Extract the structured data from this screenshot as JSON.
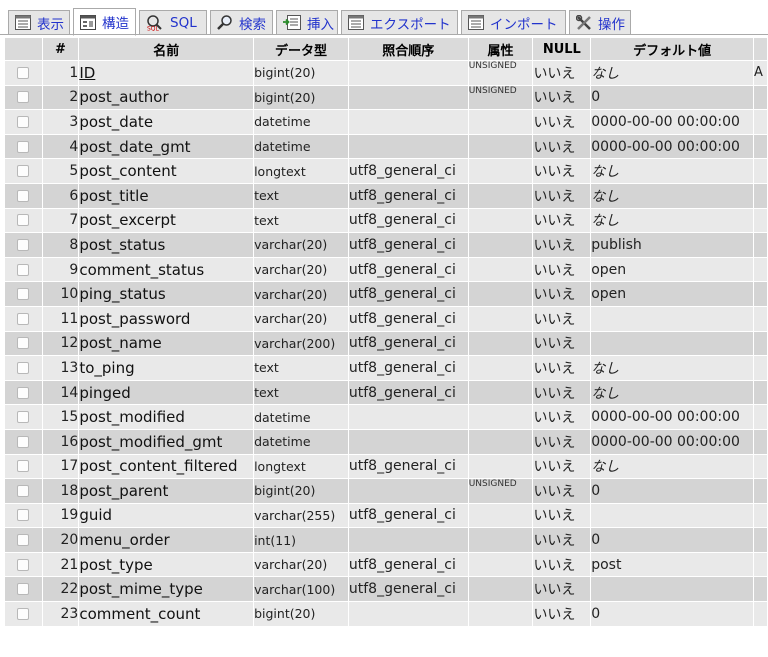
{
  "tabs": [
    {
      "label": "表示",
      "icon": "browse-icon",
      "active": false
    },
    {
      "label": "構造",
      "icon": "structure-icon",
      "active": true
    },
    {
      "label": "SQL",
      "icon": "sql-icon",
      "active": false
    },
    {
      "label": "検索",
      "icon": "search-icon",
      "active": false
    },
    {
      "label": "挿入",
      "icon": "insert-icon",
      "active": false
    },
    {
      "label": "エクスポート",
      "icon": "export-icon",
      "active": false
    },
    {
      "label": "インポート",
      "icon": "import-icon",
      "active": false
    },
    {
      "label": "操作",
      "icon": "operations-icon",
      "active": false
    }
  ],
  "columns": {
    "num": "#",
    "name": "名前",
    "type": "データ型",
    "collation": "照合順序",
    "attributes": "属性",
    "null": "NULL",
    "default": "デフォルト値"
  },
  "rows": [
    {
      "num": "1",
      "name": "ID",
      "type": "bigint(20)",
      "collation": "",
      "attributes": "UNSIGNED",
      "null": "いいえ",
      "default": "なし",
      "extra": "A"
    },
    {
      "num": "2",
      "name": "post_author",
      "type": "bigint(20)",
      "collation": "",
      "attributes": "UNSIGNED",
      "null": "いいえ",
      "default": "0",
      "extra": ""
    },
    {
      "num": "3",
      "name": "post_date",
      "type": "datetime",
      "collation": "",
      "attributes": "",
      "null": "いいえ",
      "default": "0000-00-00 00:00:00",
      "extra": ""
    },
    {
      "num": "4",
      "name": "post_date_gmt",
      "type": "datetime",
      "collation": "",
      "attributes": "",
      "null": "いいえ",
      "default": "0000-00-00 00:00:00",
      "extra": ""
    },
    {
      "num": "5",
      "name": "post_content",
      "type": "longtext",
      "collation": "utf8_general_ci",
      "attributes": "",
      "null": "いいえ",
      "default": "なし",
      "extra": ""
    },
    {
      "num": "6",
      "name": "post_title",
      "type": "text",
      "collation": "utf8_general_ci",
      "attributes": "",
      "null": "いいえ",
      "default": "なし",
      "extra": ""
    },
    {
      "num": "7",
      "name": "post_excerpt",
      "type": "text",
      "collation": "utf8_general_ci",
      "attributes": "",
      "null": "いいえ",
      "default": "なし",
      "extra": ""
    },
    {
      "num": "8",
      "name": "post_status",
      "type": "varchar(20)",
      "collation": "utf8_general_ci",
      "attributes": "",
      "null": "いいえ",
      "default": "publish",
      "extra": ""
    },
    {
      "num": "9",
      "name": "comment_status",
      "type": "varchar(20)",
      "collation": "utf8_general_ci",
      "attributes": "",
      "null": "いいえ",
      "default": "open",
      "extra": ""
    },
    {
      "num": "10",
      "name": "ping_status",
      "type": "varchar(20)",
      "collation": "utf8_general_ci",
      "attributes": "",
      "null": "いいえ",
      "default": "open",
      "extra": ""
    },
    {
      "num": "11",
      "name": "post_password",
      "type": "varchar(20)",
      "collation": "utf8_general_ci",
      "attributes": "",
      "null": "いいえ",
      "default": "",
      "extra": ""
    },
    {
      "num": "12",
      "name": "post_name",
      "type": "varchar(200)",
      "collation": "utf8_general_ci",
      "attributes": "",
      "null": "いいえ",
      "default": "",
      "extra": ""
    },
    {
      "num": "13",
      "name": "to_ping",
      "type": "text",
      "collation": "utf8_general_ci",
      "attributes": "",
      "null": "いいえ",
      "default": "なし",
      "extra": ""
    },
    {
      "num": "14",
      "name": "pinged",
      "type": "text",
      "collation": "utf8_general_ci",
      "attributes": "",
      "null": "いいえ",
      "default": "なし",
      "extra": ""
    },
    {
      "num": "15",
      "name": "post_modified",
      "type": "datetime",
      "collation": "",
      "attributes": "",
      "null": "いいえ",
      "default": "0000-00-00 00:00:00",
      "extra": ""
    },
    {
      "num": "16",
      "name": "post_modified_gmt",
      "type": "datetime",
      "collation": "",
      "attributes": "",
      "null": "いいえ",
      "default": "0000-00-00 00:00:00",
      "extra": ""
    },
    {
      "num": "17",
      "name": "post_content_filtered",
      "type": "longtext",
      "collation": "utf8_general_ci",
      "attributes": "",
      "null": "いいえ",
      "default": "なし",
      "extra": ""
    },
    {
      "num": "18",
      "name": "post_parent",
      "type": "bigint(20)",
      "collation": "",
      "attributes": "UNSIGNED",
      "null": "いいえ",
      "default": "0",
      "extra": ""
    },
    {
      "num": "19",
      "name": "guid",
      "type": "varchar(255)",
      "collation": "utf8_general_ci",
      "attributes": "",
      "null": "いいえ",
      "default": "",
      "extra": ""
    },
    {
      "num": "20",
      "name": "menu_order",
      "type": "int(11)",
      "collation": "",
      "attributes": "",
      "null": "いいえ",
      "default": "0",
      "extra": ""
    },
    {
      "num": "21",
      "name": "post_type",
      "type": "varchar(20)",
      "collation": "utf8_general_ci",
      "attributes": "",
      "null": "いいえ",
      "default": "post",
      "extra": ""
    },
    {
      "num": "22",
      "name": "post_mime_type",
      "type": "varchar(100)",
      "collation": "utf8_general_ci",
      "attributes": "",
      "null": "いいえ",
      "default": "",
      "extra": ""
    },
    {
      "num": "23",
      "name": "comment_count",
      "type": "bigint(20)",
      "collation": "",
      "attributes": "",
      "null": "いいえ",
      "default": "0",
      "extra": ""
    }
  ],
  "primary_key": "ID",
  "italic_default": "なし",
  "colors": {
    "header_bg": "#dadada",
    "row_odd": "#e9e9e9",
    "row_even": "#d4d4d4",
    "tab_text": "#2233cc"
  }
}
